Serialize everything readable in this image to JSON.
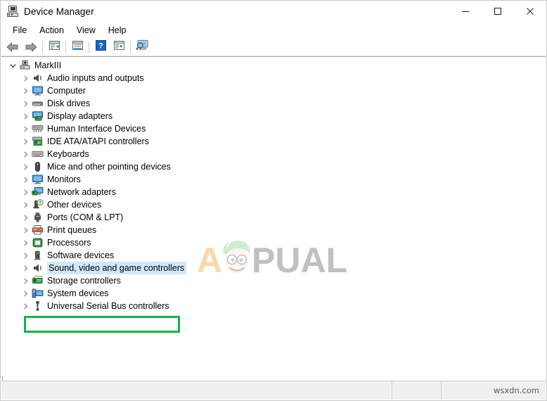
{
  "window": {
    "title": "Device Manager",
    "icon": "device-manager-icon",
    "controls": {
      "minimize": "minimize-icon",
      "maximize": "maximize-icon",
      "close": "close-icon"
    }
  },
  "menubar": {
    "items": [
      {
        "label": "File"
      },
      {
        "label": "Action"
      },
      {
        "label": "View"
      },
      {
        "label": "Help"
      }
    ]
  },
  "toolbar": {
    "buttons": [
      {
        "name": "back-icon",
        "tip": "Back"
      },
      {
        "name": "forward-icon",
        "tip": "Forward"
      },
      {
        "name": "properties-icon",
        "tip": "Properties"
      },
      {
        "name": "update-driver-icon",
        "tip": "Update driver"
      },
      {
        "name": "help-icon",
        "tip": "Help"
      },
      {
        "name": "scan-hardware-changes-icon",
        "tip": "Scan for hardware changes"
      },
      {
        "name": "show-hidden-devices-icon",
        "tip": "Show hidden devices"
      }
    ]
  },
  "tree": {
    "root": {
      "label": "MarkIII",
      "icon": "computer-node-icon",
      "expanded": true
    },
    "items": [
      {
        "label": "Audio inputs and outputs",
        "icon": "speaker-icon"
      },
      {
        "label": "Computer",
        "icon": "monitor-icon"
      },
      {
        "label": "Disk drives",
        "icon": "disk-drive-icon"
      },
      {
        "label": "Display adapters",
        "icon": "display-adapter-icon"
      },
      {
        "label": "Human Interface Devices",
        "icon": "hid-icon"
      },
      {
        "label": "IDE ATA/ATAPI controllers",
        "icon": "ide-controller-icon"
      },
      {
        "label": "Keyboards",
        "icon": "keyboard-icon"
      },
      {
        "label": "Mice and other pointing devices",
        "icon": "mouse-icon"
      },
      {
        "label": "Monitors",
        "icon": "monitor-icon"
      },
      {
        "label": "Network adapters",
        "icon": "network-adapter-icon"
      },
      {
        "label": "Other devices",
        "icon": "other-devices-icon"
      },
      {
        "label": "Ports (COM & LPT)",
        "icon": "port-icon"
      },
      {
        "label": "Print queues",
        "icon": "printer-icon"
      },
      {
        "label": "Processors",
        "icon": "processor-icon"
      },
      {
        "label": "Software devices",
        "icon": "software-device-icon"
      },
      {
        "label": "Sound, video and game controllers",
        "icon": "speaker-icon",
        "selected": true,
        "highlighted": true
      },
      {
        "label": "Storage controllers",
        "icon": "storage-controller-icon"
      },
      {
        "label": "System devices",
        "icon": "system-device-icon"
      },
      {
        "label": "Universal Serial Bus controllers",
        "icon": "usb-icon"
      }
    ]
  },
  "annotation": {
    "highlight_box": {
      "color": "#17b24a",
      "target": "Sound, video and game controllers"
    },
    "selection_color": "#cfe8fa"
  },
  "watermark": {
    "text_left": "A",
    "text_right": "PUALS",
    "accent": "#f39200",
    "dark": "#4a4a4a"
  },
  "statusbar": {
    "segment1": "",
    "segment2": "",
    "site": "wsxdn.com"
  }
}
